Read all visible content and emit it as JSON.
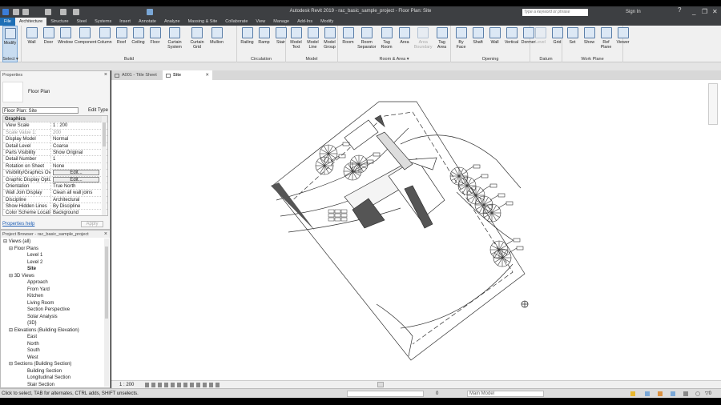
{
  "window": {
    "title": "Autodesk Revit 2019 - rac_basic_sample_project - Floor Plan: Site",
    "search_placeholder": "Type a keyword or phrase",
    "sign_in": "Sign In"
  },
  "ribbon_tabs": [
    "File",
    "Architecture",
    "Structure",
    "Steel",
    "Systems",
    "Insert",
    "Annotate",
    "Analyze",
    "Massing & Site",
    "Collaborate",
    "View",
    "Manage",
    "Add-Ins",
    "Modify"
  ],
  "panels": [
    {
      "label": "Select ▾",
      "buttons": [
        "Modify"
      ]
    },
    {
      "label": "Build",
      "buttons": [
        "Wall",
        "Door",
        "Window",
        "Component",
        "Column",
        "Roof",
        "Ceiling",
        "Floor",
        "Curtain System",
        "Curtain Grid",
        "Mullion"
      ]
    },
    {
      "label": "Circulation",
      "buttons": [
        "Railing",
        "Ramp",
        "Stair"
      ]
    },
    {
      "label": "Model",
      "buttons": [
        "Model Text",
        "Model Line",
        "Model Group"
      ]
    },
    {
      "label": "Room & Area ▾",
      "buttons": [
        "Room",
        "Room Separator",
        "Tag Room",
        "Area",
        "Area Boundary",
        "Tag Area"
      ]
    },
    {
      "label": "Opening",
      "buttons": [
        "By Face",
        "Shaft",
        "Wall",
        "Vertical",
        "Dormer"
      ]
    },
    {
      "label": "Datum",
      "buttons": [
        "Level",
        "Grid"
      ]
    },
    {
      "label": "Work Plane",
      "buttons": [
        "Set",
        "Show",
        "Ref Plane",
        "Viewer"
      ]
    }
  ],
  "properties": {
    "title": "Properties",
    "type": "Floor Plan",
    "filter": "Floor Plan: Site",
    "edit_type": "Edit Type",
    "group": "Graphics",
    "rows": [
      {
        "k": "View Scale",
        "v": "1 : 200"
      },
      {
        "k": "Scale Value    1:",
        "v": "200"
      },
      {
        "k": "Display Model",
        "v": "Normal"
      },
      {
        "k": "Detail Level",
        "v": "Coarse"
      },
      {
        "k": "Parts Visibility",
        "v": "Show Original"
      },
      {
        "k": "Detail Number",
        "v": "1"
      },
      {
        "k": "Rotation on Sheet",
        "v": "None"
      },
      {
        "k": "Visibility/Graphics Ov...",
        "v": "Edit..."
      },
      {
        "k": "Graphic Display Opti...",
        "v": "Edit..."
      },
      {
        "k": "Orientation",
        "v": "True North"
      },
      {
        "k": "Wall Join Display",
        "v": "Clean all wall joins"
      },
      {
        "k": "Discipline",
        "v": "Architectural"
      },
      {
        "k": "Show Hidden Lines",
        "v": "By Discipline"
      },
      {
        "k": "Color Scheme Location",
        "v": "Background"
      },
      {
        "k": "Color Scheme",
        "v": ""
      }
    ],
    "help": "Properties help",
    "apply": "Apply"
  },
  "browser": {
    "title": "Project Browser - rac_basic_sample_project",
    "root": "Views (all)",
    "floor_plans": "Floor Plans",
    "fp": [
      "Level 1",
      "Level 2",
      "Site"
    ],
    "views3d": "3D Views",
    "v3": [
      "Approach",
      "From Yard",
      "Kitchen",
      "Living Room",
      "Section Perspective",
      "Solar Analysis",
      "{3D}"
    ],
    "elevations": "Elevations (Building Elevation)",
    "el": [
      "East",
      "North",
      "South",
      "West"
    ],
    "sections": "Sections (Building Section)",
    "se": [
      "Building Section",
      "Longitudinal Section",
      "Stair Section"
    ]
  },
  "view_tabs": [
    "A001 - Title Sheet",
    "Site"
  ],
  "view_scale": "1 : 200",
  "status": {
    "message": "Click to select, TAB for alternates, CTRL adds, SHIFT unselects.",
    "selection_count": "0",
    "model": "Main Model",
    "filter_count": "0"
  }
}
